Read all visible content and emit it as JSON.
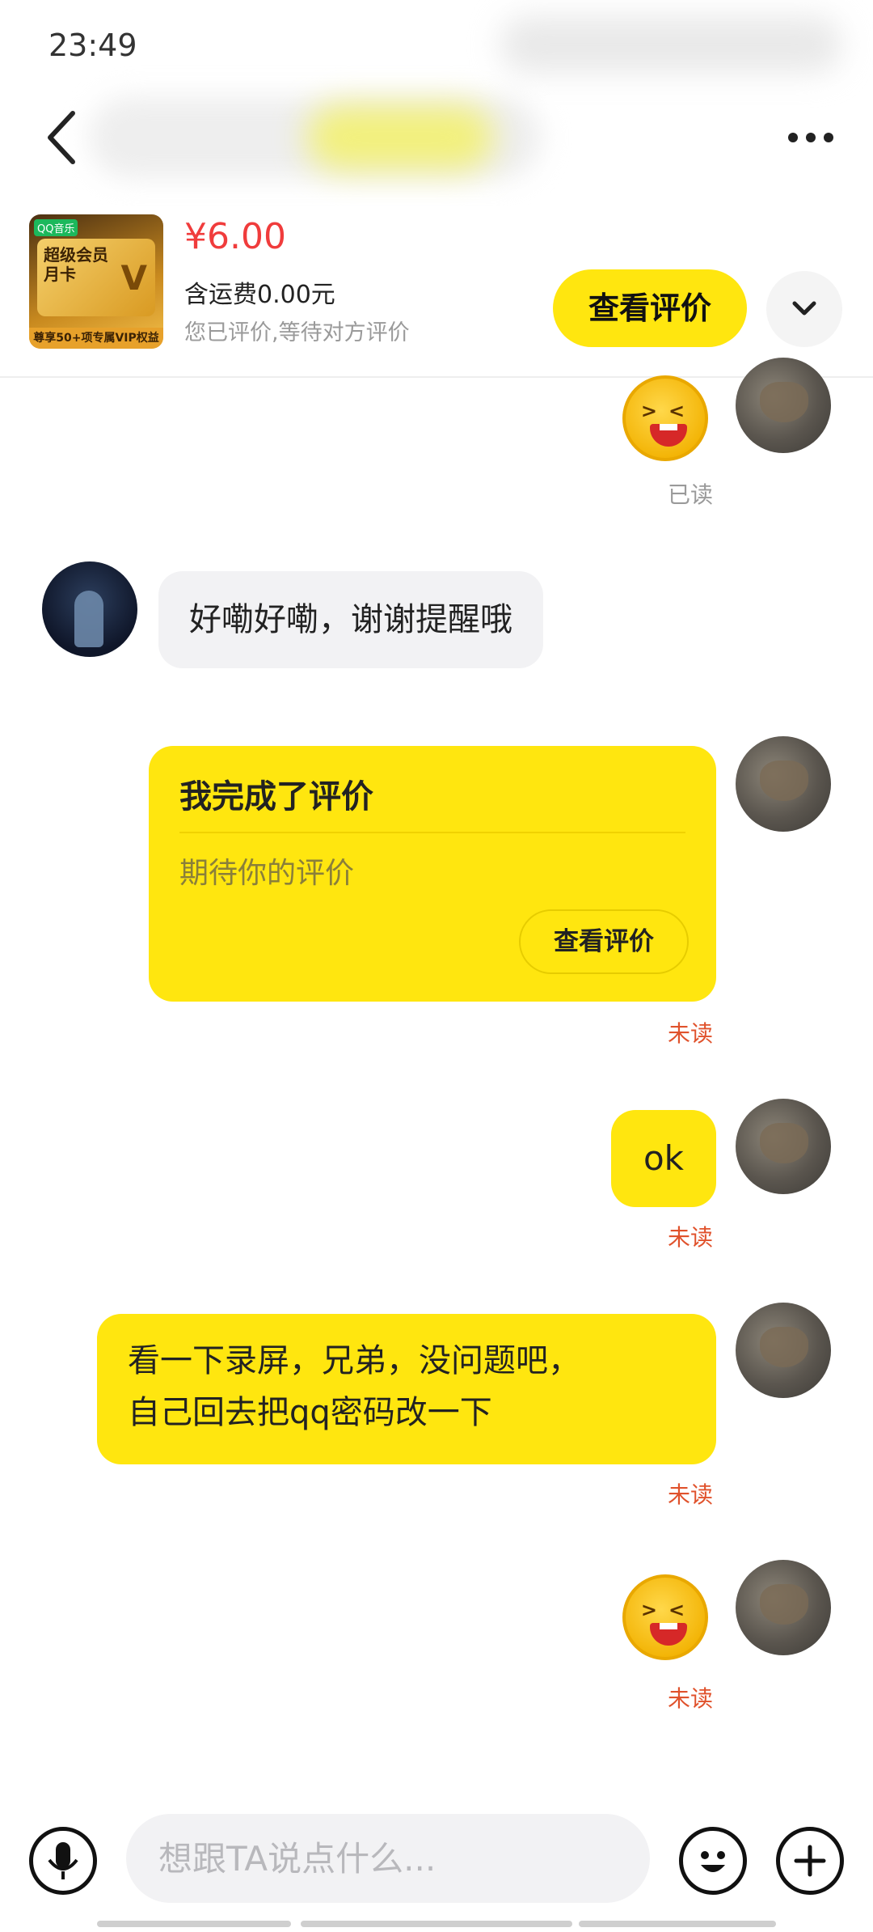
{
  "status_bar": {
    "time": "23:49"
  },
  "header": {
    "back_icon": "chevron-left-icon",
    "more_icon": "more-dots-icon"
  },
  "order": {
    "product_badge": "QQ音乐",
    "product_card_title": "超级会员\n月卡",
    "product_bottom_text": "尊享50+项专属VIP权益",
    "price": "¥6.00",
    "shipping": "含运费0.00元",
    "review_status": "您已评价,等待对方评价",
    "view_review_button": "查看评价",
    "expand_icon": "chevron-down-icon"
  },
  "messages": {
    "read_label": "已读",
    "other_text_1": "好嘞好嘞，谢谢提醒哦",
    "review_card": {
      "title": "我完成了评价",
      "subtitle": "期待你的评价",
      "button": "查看评价"
    },
    "unread_label_1": "未读",
    "self_text_ok": "ok",
    "unread_label_2": "未读",
    "self_text_long_line1": "看一下录屏，兄弟，没问题吧，",
    "self_text_long_line2": "自己回去把qq密码改一下",
    "unread_label_3": "未读",
    "unread_label_4": "未读"
  },
  "input_bar": {
    "placeholder": "想跟TA说点什么...",
    "voice_icon": "microphone-icon",
    "emoji_icon": "smiley-icon",
    "plus_icon": "plus-icon"
  },
  "colors": {
    "accent_yellow": "#ffe60f",
    "price_red": "#f03c3c",
    "unread_orange": "#e0522c",
    "read_gray": "#9a9a9a"
  }
}
